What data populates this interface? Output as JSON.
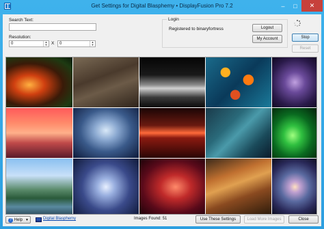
{
  "window": {
    "title": "Get Settings for Digital Blasphemy • DisplayFusion Pro 7.2",
    "minimize": "–",
    "maximize": "□",
    "close": "✕"
  },
  "search": {
    "label": "Search Text:",
    "value": "",
    "placeholder": ""
  },
  "resolution": {
    "label": "Resolution:",
    "width": "0",
    "height": "0",
    "separator": "X"
  },
  "login": {
    "group_title": "Login",
    "status": "Registered to binaryfortress",
    "logout_label": "Logout",
    "my_account_label": "My Account"
  },
  "actions": {
    "stop_label": "Stop",
    "reset_label": "Reset"
  },
  "gallery": {
    "images": [
      {
        "subject": "fiery forest"
      },
      {
        "subject": "rocky canyon"
      },
      {
        "subject": "dark ocean wave"
      },
      {
        "subject": "fractal bubbles"
      },
      {
        "subject": "purple fractal"
      },
      {
        "subject": "pink desert sunset"
      },
      {
        "subject": "blue ice crystal tree"
      },
      {
        "subject": "red ocean horizon"
      },
      {
        "subject": "teal fractal tower"
      },
      {
        "subject": "green glowing plants"
      },
      {
        "subject": "mountain lake"
      },
      {
        "subject": "snowflake"
      },
      {
        "subject": "red nebula"
      },
      {
        "subject": "orange rock formation"
      },
      {
        "subject": "spiral fractal"
      }
    ]
  },
  "footer": {
    "help_label": "Help",
    "help_icon": "question-icon",
    "source_link": "Digital Blasphemy",
    "images_found": "Images Found: 51",
    "use_settings_label": "Use These Settings",
    "load_more_label": "Load More Images",
    "close_label": "Close"
  }
}
